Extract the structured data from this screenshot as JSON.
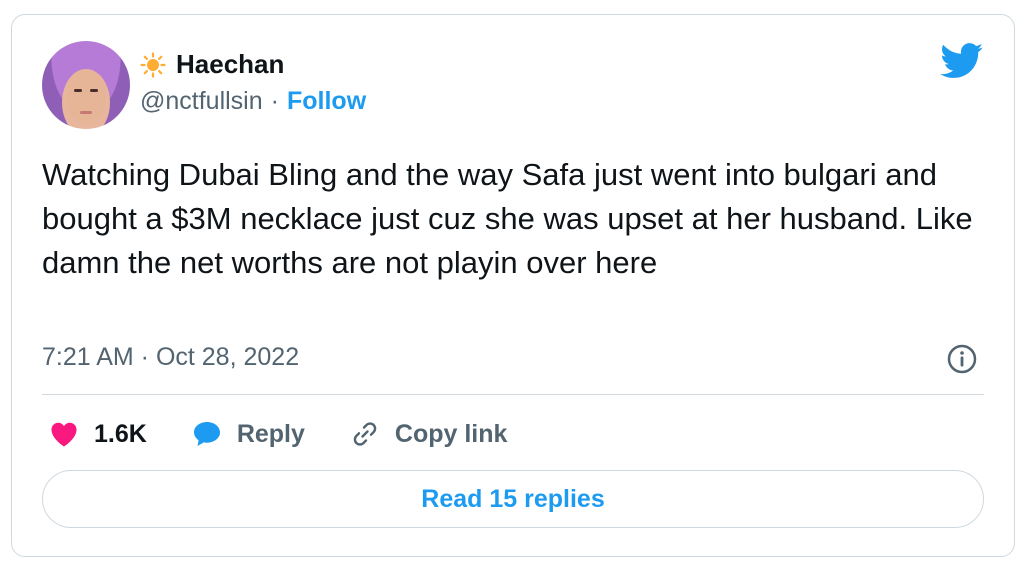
{
  "author": {
    "display_name": "Haechan",
    "handle": "@nctfullsin",
    "separator": "·",
    "follow_label": "Follow",
    "name_emoji": "sun-icon"
  },
  "tweet": {
    "text": "Watching Dubai Bling and the way Safa just went into bulgari and bought a $3M necklace just cuz she was upset at her husband. Like damn the net worths are not playin over here",
    "timestamp": "7:21 AM · Oct 28, 2022"
  },
  "actions": {
    "likes_count": "1.6K",
    "reply_label": "Reply",
    "copy_link_label": "Copy link"
  },
  "read_replies_label": "Read 15 replies",
  "colors": {
    "accent": "#1d9bf0",
    "heart": "#f91880",
    "text": "#0f1419",
    "muted": "#536471",
    "border": "#cfd9de"
  }
}
